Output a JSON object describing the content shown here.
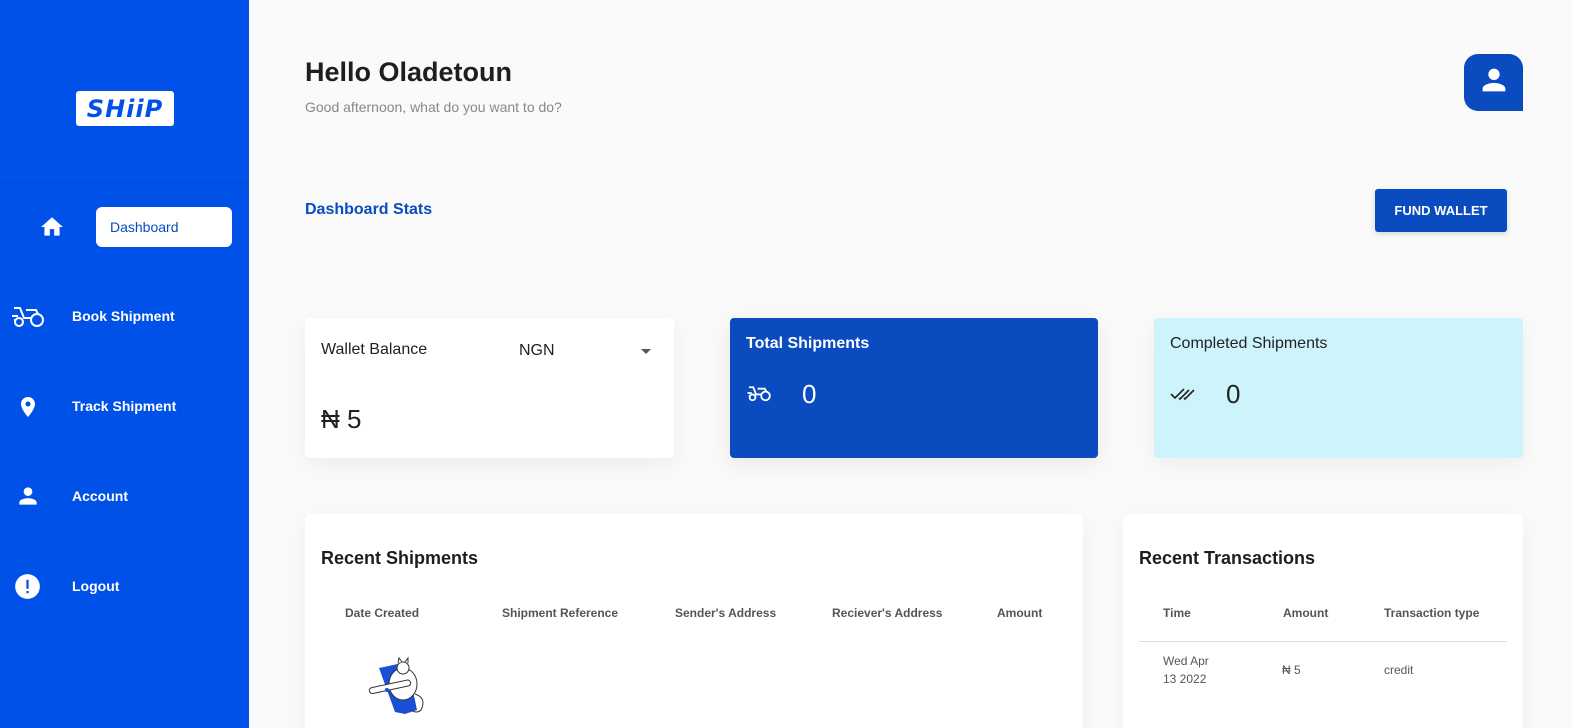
{
  "brand": {
    "logo_text": "SHiiP"
  },
  "sidebar": {
    "items": [
      {
        "label": "Dashboard",
        "icon": "home-icon",
        "active": true
      },
      {
        "label": "Book Shipment",
        "icon": "delivery-scooter-icon"
      },
      {
        "label": "Track Shipment",
        "icon": "location-pin-icon"
      },
      {
        "label": "Account",
        "icon": "person-icon"
      },
      {
        "label": "Logout",
        "icon": "alert-circle-icon"
      }
    ]
  },
  "header": {
    "greeting": "Hello Oladetoun",
    "subtitle": "Good afternoon, what do you want to do?",
    "avatar_icon": "user-avatar-icon"
  },
  "stats": {
    "title": "Dashboard Stats",
    "fund_button": "FUND WALLET",
    "wallet": {
      "label": "Wallet Balance",
      "currency": "NGN",
      "value": "₦ 5"
    },
    "total": {
      "label": "Total Shipments",
      "value": "0"
    },
    "completed": {
      "label": "Completed Shipments",
      "value": "0"
    }
  },
  "recent_shipments": {
    "title": "Recent Shipments",
    "columns": [
      "Date Created",
      "Shipment Reference",
      "Sender's Address",
      "Reciever's Address",
      "Amount"
    ]
  },
  "recent_transactions": {
    "title": "Recent Transactions",
    "columns": [
      "Time",
      "Amount",
      "Transaction type"
    ],
    "rows": [
      {
        "time_line1": "Wed Apr",
        "time_line2": "13 2022",
        "amount": "₦ 5",
        "type": "credit"
      }
    ]
  },
  "colors": {
    "sidebar": "#0051e8",
    "primary": "#0a4bbf",
    "completed_card": "#cdf4fb"
  }
}
